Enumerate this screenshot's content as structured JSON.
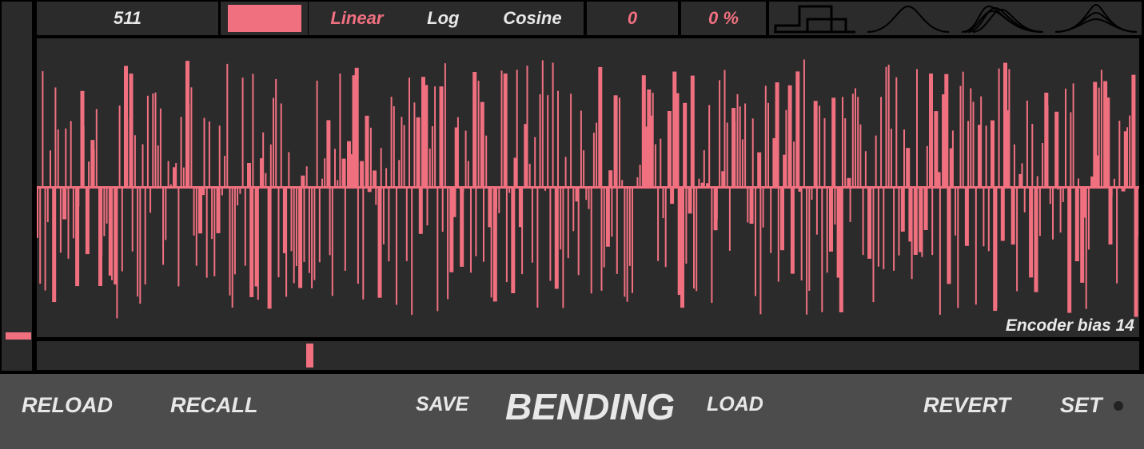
{
  "top_bar": {
    "value": "511",
    "color_swatch": "#f07080",
    "curve_options": [
      {
        "label": "Linear",
        "selected": true
      },
      {
        "label": "Log",
        "selected": false
      },
      {
        "label": "Cosine",
        "selected": false
      }
    ],
    "offset_value": "0",
    "percent_value": "0 %",
    "distribution_icons": [
      "uniform-distribution-icon",
      "gaussian-distribution-icon",
      "multi-peak-distribution-icon",
      "narrow-peak-distribution-icon"
    ]
  },
  "waveform": {
    "label": "Encoder bias 14",
    "color": "#f07080"
  },
  "bottom_bar": {
    "reload": "RELOAD",
    "recall": "RECALL",
    "save": "SAVE",
    "title": "BENDING",
    "load": "LOAD",
    "revert": "REVERT",
    "set": "SET"
  },
  "colors": {
    "accent": "#f07080",
    "panel": "#2b2b2b",
    "footer": "#4c4c4c",
    "text": "#e8e8e8"
  }
}
